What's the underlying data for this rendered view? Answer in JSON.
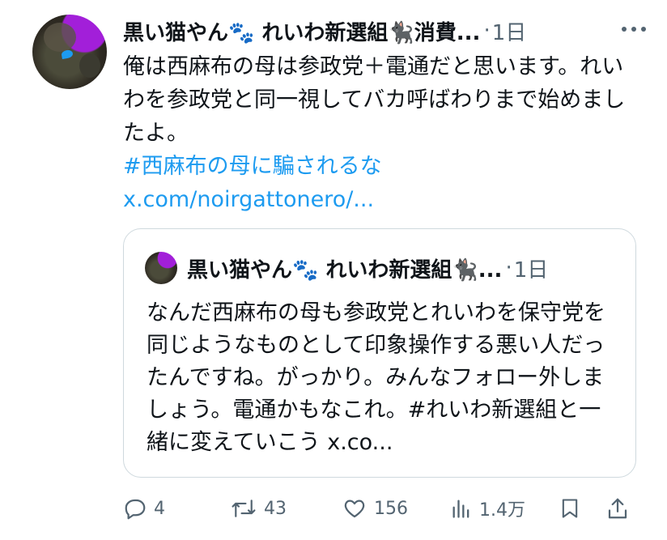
{
  "author": {
    "name": "黒い猫やん🐾 れいわ新選組🐈‍⬛消費...",
    "separator": "·",
    "time": "1日"
  },
  "body": {
    "text": "俺は西麻布の母は参政党＋電通だと思います。れいわを参政党と同一視してバカ呼ばわりまで始めましたよ。",
    "hashtag": "#西麻布の母に騙されるな",
    "link": "x.com/noirgattonero/..."
  },
  "quote": {
    "name": "黒い猫やん🐾 れいわ新選組🐈‍⬛...",
    "separator": "·",
    "time": "1日",
    "text": "なんだ西麻布の母も参政党とれいわを保守党を同じようなものとして印象操作する悪い人だったんですね。がっかり。みんなフォロー外しましょう。電通かもなこれ。#れいわ新選組と一緒に変えていこう x.co..."
  },
  "actions": {
    "replies": "4",
    "reposts": "43",
    "likes": "156",
    "views": "1.4万"
  },
  "colors": {
    "accent": "#1d9bf0",
    "muted": "#536471",
    "text": "#0f1419",
    "border": "#cfd9de"
  },
  "icons": [
    "more-icon",
    "reply-icon",
    "repost-icon",
    "like-icon",
    "views-icon",
    "bookmark-icon",
    "share-icon"
  ]
}
